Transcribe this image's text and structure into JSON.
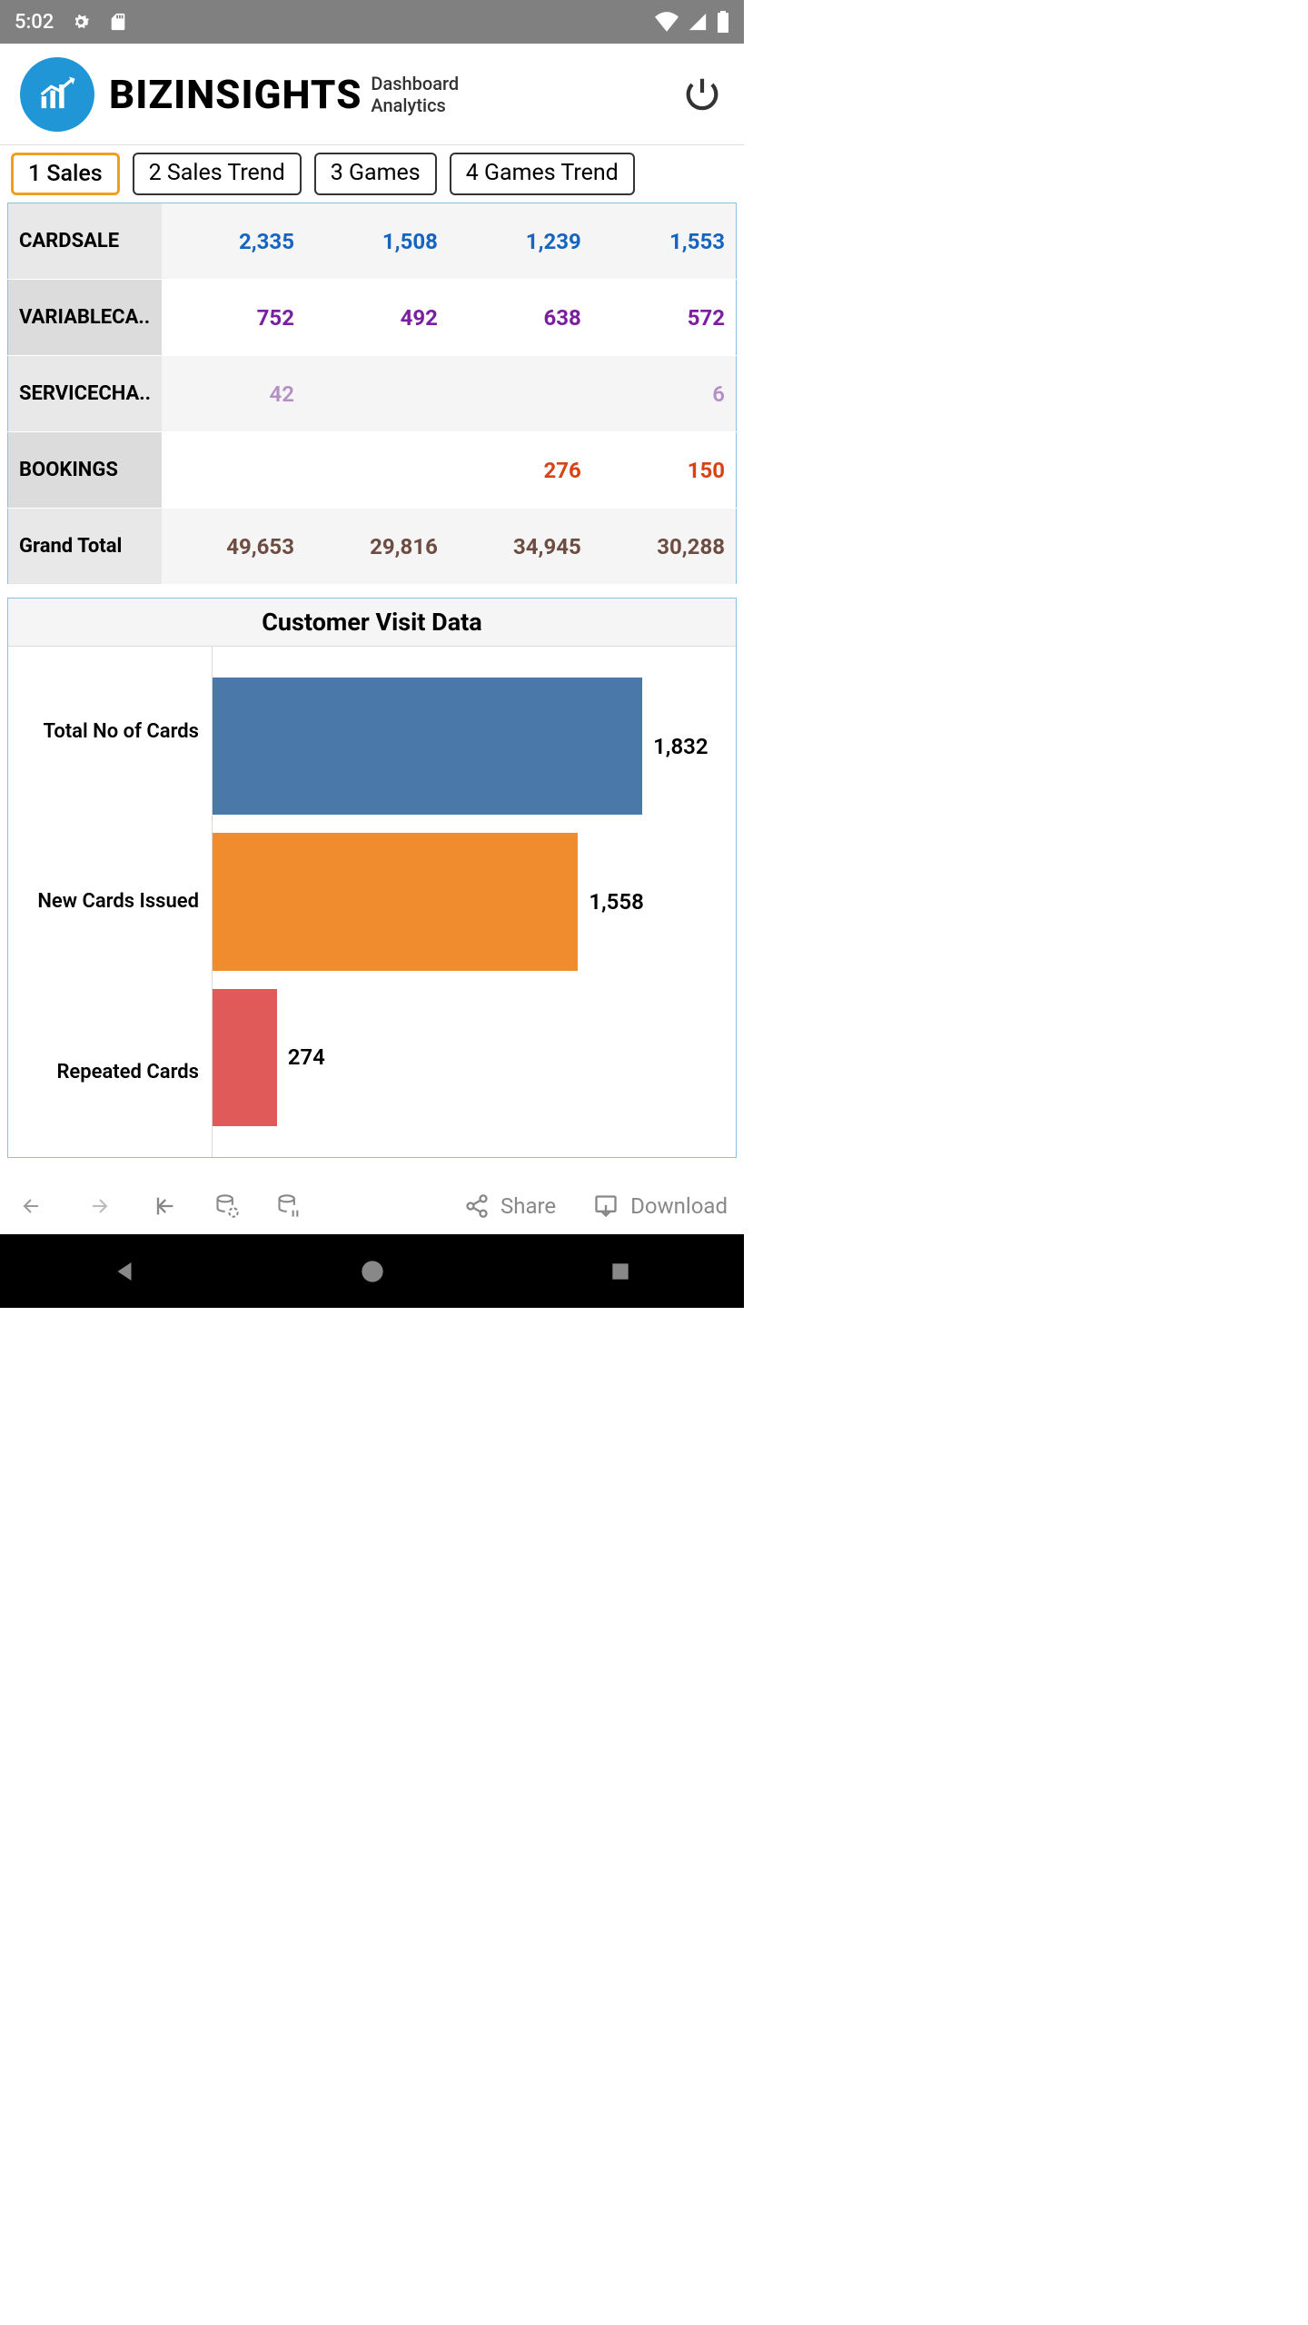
{
  "status": {
    "time": "5:02"
  },
  "header": {
    "brand_main": "BIZINSIGHTS",
    "brand_sub1": "Dashboard",
    "brand_sub2": "Analytics"
  },
  "tabs": [
    {
      "label": "1 Sales",
      "active": true
    },
    {
      "label": "2 Sales Trend",
      "active": false
    },
    {
      "label": "3 Games",
      "active": false
    },
    {
      "label": "4 Games Trend",
      "active": false
    }
  ],
  "table": {
    "rows": [
      {
        "label": "CARDSALE",
        "cells": [
          "2,335",
          "1,508",
          "1,239",
          "1,553"
        ],
        "cls": "val-blue"
      },
      {
        "label": "VARIABLECA..",
        "cells": [
          "752",
          "492",
          "638",
          "572"
        ],
        "cls": "val-purple"
      },
      {
        "label": "SERVICECHA..",
        "cells": [
          "42",
          "",
          "",
          "6"
        ],
        "cls": "val-lightpurple"
      },
      {
        "label": "BOOKINGS",
        "cells": [
          "",
          "",
          "276",
          "150"
        ],
        "cls": "val-red"
      },
      {
        "label": "Grand Total",
        "cells": [
          "49,653",
          "29,816",
          "34,945",
          "30,288"
        ],
        "cls": "val-brown"
      }
    ]
  },
  "chart_data": {
    "type": "bar",
    "title": "Customer Visit Data",
    "categories": [
      "Total No of Cards",
      "New Cards Issued",
      "Repeated  Cards"
    ],
    "values": [
      1832,
      1558,
      274
    ],
    "value_labels": [
      "1,832",
      "1,558",
      "274"
    ],
    "colors": [
      "#4a78a8",
      "#f08c2e",
      "#e05a5a"
    ],
    "max": 1832
  },
  "toolbar": {
    "share": "Share",
    "download": "Download"
  }
}
